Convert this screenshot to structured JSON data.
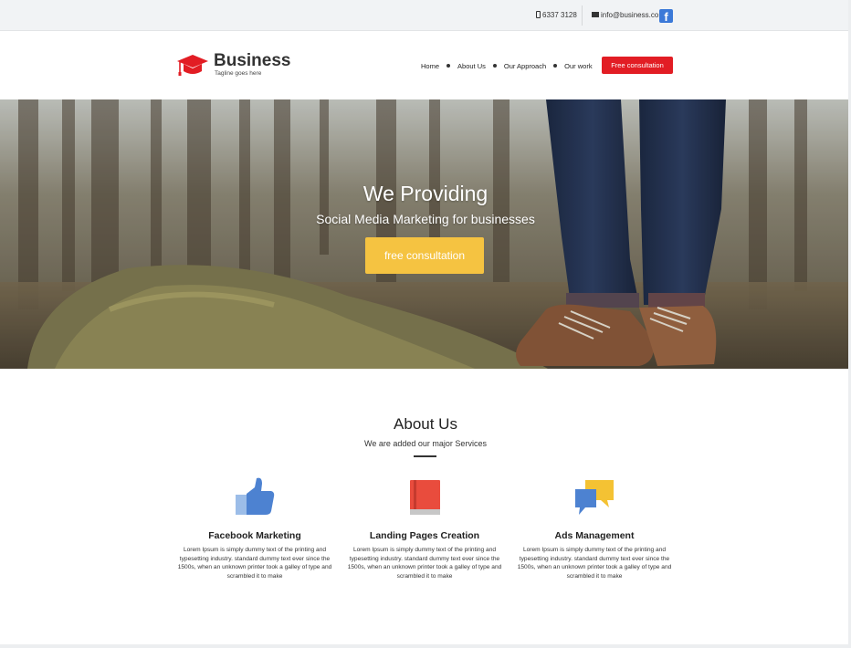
{
  "topbar": {
    "phone": "6337 3128",
    "email": "info@business.co",
    "facebook_letter": "f",
    "phone_icon": "phone-icon",
    "mail_icon": "mail-icon"
  },
  "header": {
    "brand": "Business",
    "tagline": "Tagline goes here",
    "logo_icon": "graduation-cap-icon",
    "nav": [
      {
        "label": "Home"
      },
      {
        "label": "About Us"
      },
      {
        "label": "Our Approach"
      },
      {
        "label": "Our work"
      }
    ],
    "cta": "Free consultation"
  },
  "hero": {
    "title": "We Providing",
    "subtitle": "Social Media Marketing for businesses",
    "cta": "free consultation"
  },
  "about": {
    "title": "About Us",
    "subtitle": "We are added our major Services",
    "services": [
      {
        "icon": "thumbs-up-icon",
        "name": "Facebook Marketing",
        "desc": "Lorem Ipsum is simply dummy text of the printing and typesetting industry. standard dummy text ever since the 1500s, when an unknown printer took a galley of type and scrambled it to make"
      },
      {
        "icon": "book-icon",
        "name": "Landing Pages Creation",
        "desc": "Lorem Ipsum is simply dummy text of the printing and typesetting industry. standard dummy text ever since the 1500s, when an unknown printer took a galley of type and scrambled it to make"
      },
      {
        "icon": "chat-bubbles-icon",
        "name": "Ads Management",
        "desc": "Lorem Ipsum is simply dummy text of the printing and typesetting industry. standard dummy text ever since the 1500s, when an unknown printer took a galley of type and scrambled it to make"
      }
    ]
  },
  "colors": {
    "accent_red": "#e21d24",
    "accent_yellow": "#f5c341",
    "facebook_blue": "#3b79d8"
  }
}
